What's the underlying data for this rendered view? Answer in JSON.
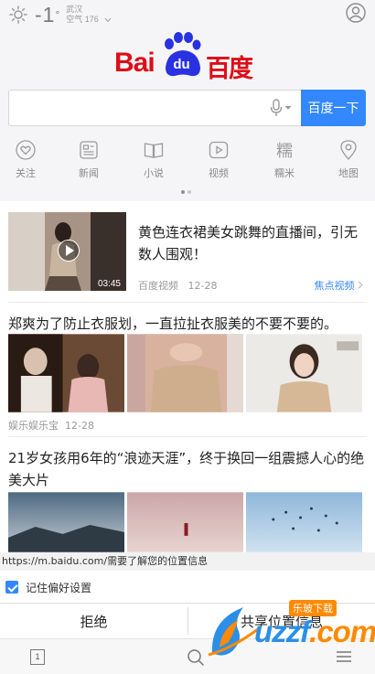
{
  "status": {
    "temperature": "-1",
    "degree": "°",
    "city": "武汉",
    "aqi": "空气 176"
  },
  "brand": {
    "logo_left": "Bai",
    "logo_mid": "du",
    "logo_right": "百度"
  },
  "search": {
    "value": "",
    "button_label": "百度一下"
  },
  "nav": {
    "items": [
      {
        "label": "关注",
        "icon": "heart-icon"
      },
      {
        "label": "新闻",
        "icon": "news-icon"
      },
      {
        "label": "小说",
        "icon": "book-icon"
      },
      {
        "label": "视频",
        "icon": "video-icon"
      },
      {
        "label": "糯米",
        "icon": "nuomi-icon"
      },
      {
        "label": "地图",
        "icon": "map-pin-icon"
      }
    ]
  },
  "feed": {
    "card1": {
      "title": "黄色连衣裙美女跳舞的直播间，引无数人围观！",
      "duration": "03:45",
      "source": "百度视频",
      "date": "12-28",
      "tag": "焦点视频"
    },
    "card2": {
      "title": "郑爽为了防止衣服划，一直拉扯衣服美的不要不要的。",
      "source": "娱乐娱乐宝",
      "date": "12-28"
    },
    "card3": {
      "title": "21岁女孩用6年的“浪迹天涯”，终于换回一组震撼人心的绝美大片"
    }
  },
  "permission": {
    "message": "https://m.baidu.com/需要了解您的位置信息",
    "remember_label": "记住偏好设置",
    "deny_label": "拒绝",
    "allow_label": "共享位置信息"
  },
  "bottom": {
    "tab_count": "1"
  },
  "watermark": {
    "badge": "乐玻下载",
    "text": "uzzf",
    "suffix": ".com"
  },
  "colors": {
    "accent": "#3388ff",
    "brand_red": "#de0d18",
    "brand_blue": "#2932e1"
  }
}
